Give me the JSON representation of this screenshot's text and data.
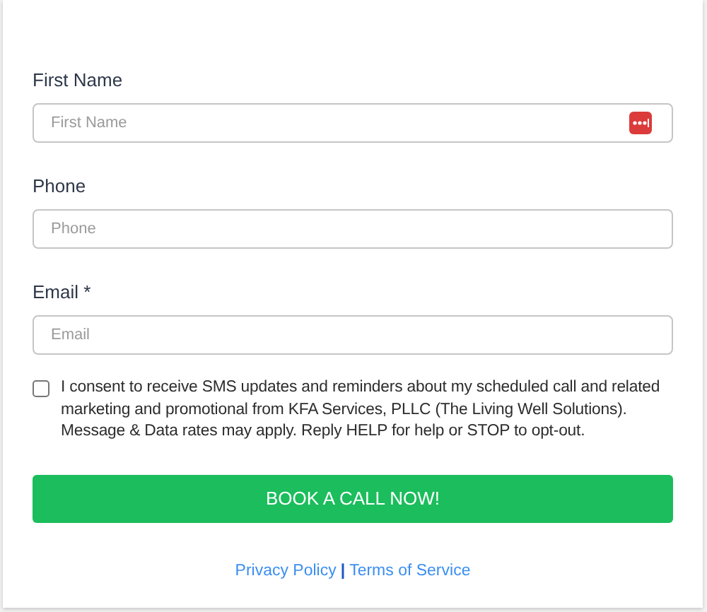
{
  "fields": [
    {
      "label": "First Name",
      "placeholder": "First Name",
      "autofill_icon": true
    },
    {
      "label": "Phone",
      "placeholder": "Phone",
      "autofill_icon": false
    },
    {
      "label": "Email *",
      "placeholder": "Email",
      "autofill_icon": false
    }
  ],
  "consent": {
    "checked": false,
    "text": "I consent to receive SMS updates and reminders about my scheduled call and related marketing and promotional from KFA Services, PLLC (The Living Well Solutions). Message & Data rates may apply. Reply HELP for help or STOP to opt-out."
  },
  "submit": "BOOK A CALL NOW!",
  "links": {
    "first": "Privacy Policy",
    "separator": "|",
    "second": "Terms of Service"
  }
}
